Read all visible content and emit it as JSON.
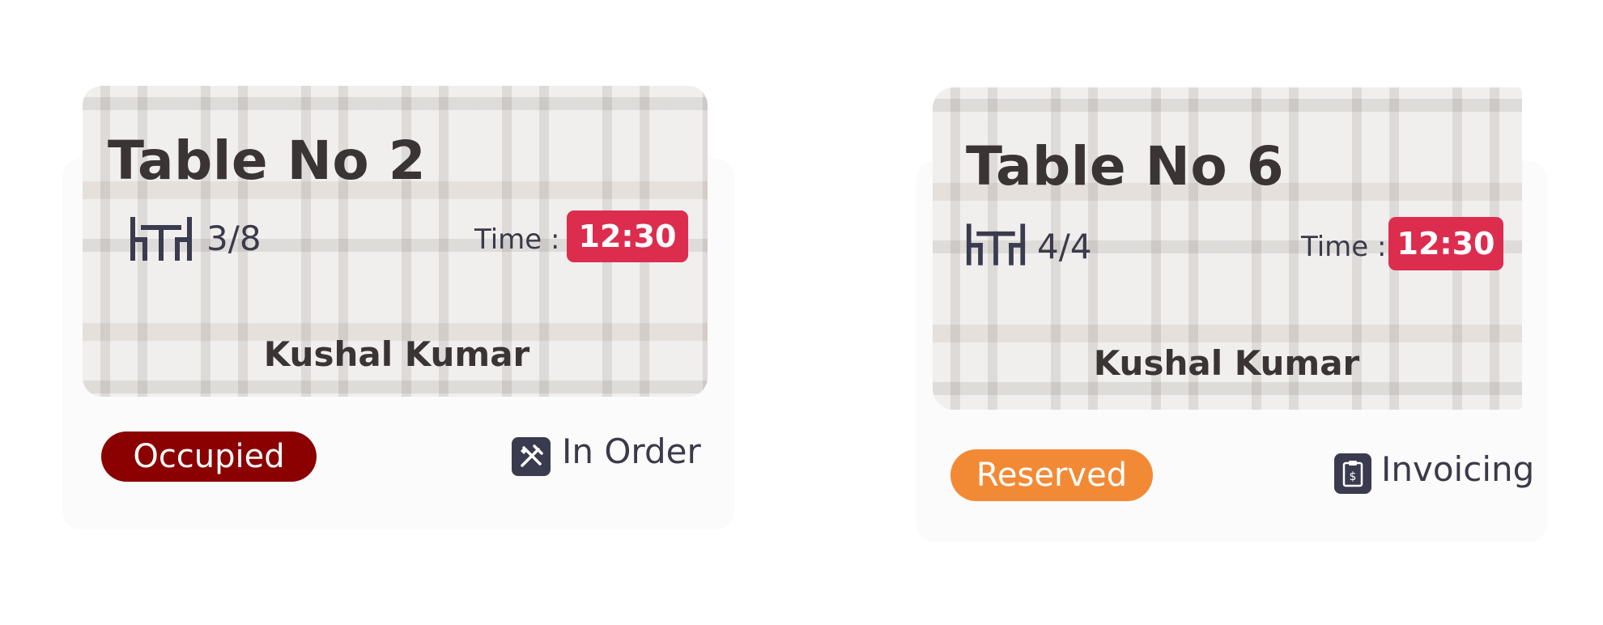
{
  "tables": [
    {
      "title": "Table No 2",
      "occupancy": "3/8",
      "time_label": "Time :",
      "time": "12:30",
      "customer": "Kushal Kumar",
      "status": "Occupied",
      "status_color": "#8b0000",
      "state": "In Order",
      "state_icon": "fork-knife-icon"
    },
    {
      "title": "Table No 6",
      "occupancy": "4/4",
      "time_label": "Time :",
      "time": "12:30",
      "customer": "Kushal Kumar",
      "status": "Reserved",
      "status_color": "#f28a35",
      "state": "Invoicing",
      "state_icon": "invoice-icon"
    }
  ],
  "colors": {
    "time_badge": "#dc2d4f",
    "icon_bg": "#3a3b4e",
    "text": "#3b3434"
  }
}
